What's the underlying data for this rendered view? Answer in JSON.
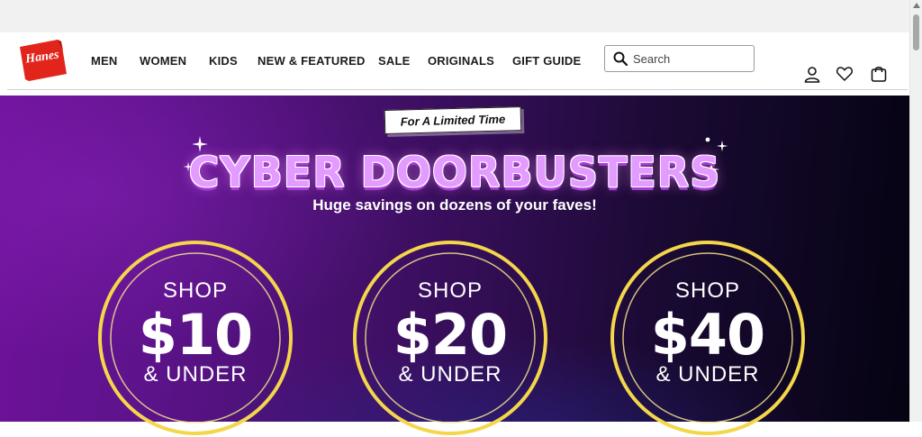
{
  "brand": {
    "logo_text": "Hanes",
    "logo_color": "#e1251b"
  },
  "nav": {
    "items": [
      {
        "label": "MEN"
      },
      {
        "label": "WOMEN"
      },
      {
        "label": "KIDS"
      },
      {
        "label": "NEW & FEATURED"
      },
      {
        "label": "SALE"
      },
      {
        "label": "ORIGINALS"
      },
      {
        "label": "GIFT GUIDE"
      }
    ]
  },
  "search": {
    "placeholder": "Search",
    "value": ""
  },
  "header_icons": [
    "account-icon",
    "wishlist-heart-icon",
    "cart-bag-icon"
  ],
  "hero": {
    "badge": "For A Limited Time",
    "headline": "CYBER DOORBUSTERS",
    "subhead": "Huge savings on dozens of your faves!",
    "circles": [
      {
        "shop": "SHOP",
        "price": "$10",
        "under": "& UNDER"
      },
      {
        "shop": "SHOP",
        "price": "$20",
        "under": "& UNDER"
      },
      {
        "shop": "SHOP",
        "price": "$40",
        "under": "& UNDER"
      }
    ],
    "colors": {
      "headline": "#e39bff",
      "ring": "#f4d64a",
      "background_start": "#6e129a",
      "background_end": "#050312"
    }
  }
}
